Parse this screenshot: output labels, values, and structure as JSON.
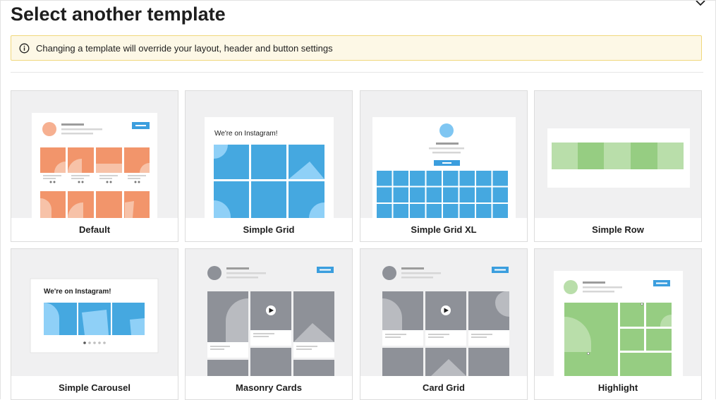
{
  "dialog": {
    "title": "Select another template",
    "notice": "Changing a template will override your layout, header and button settings"
  },
  "templates": [
    {
      "label": "Default"
    },
    {
      "label": "Simple Grid",
      "preview_heading": "We're on Instagram!"
    },
    {
      "label": "Simple Grid XL"
    },
    {
      "label": "Simple Row"
    },
    {
      "label": "Simple Carousel",
      "preview_heading": "We're on Instagram!"
    },
    {
      "label": "Masonry Cards"
    },
    {
      "label": "Card Grid"
    },
    {
      "label": "Highlight"
    }
  ],
  "colors": {
    "accent_blue": "#3b9ede",
    "orange": "#f2956b",
    "grid_blue": "#45a8e0",
    "green": "#96cd82",
    "gray_tile": "#8e9198",
    "notice_bg": "#fdf8e6",
    "notice_border": "#f0d87c"
  },
  "icons": [
    "close-icon",
    "info-icon",
    "play-icon",
    "heart-icon",
    "comment-icon"
  ]
}
